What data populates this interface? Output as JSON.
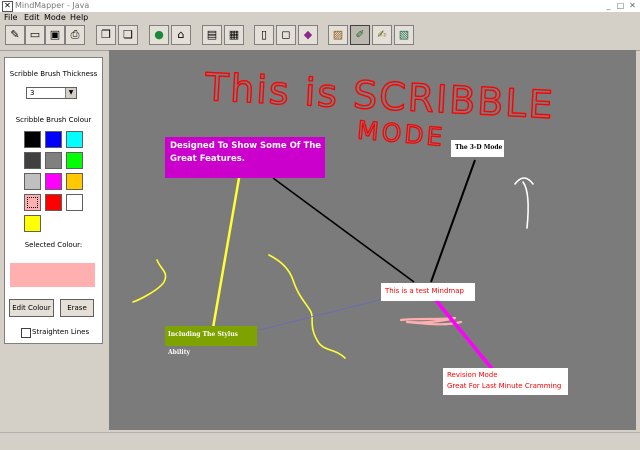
{
  "window": {
    "title": "MindMapper - Java",
    "icon_glyph": "✕",
    "controls": [
      "_",
      "□",
      "✕"
    ]
  },
  "menu": [
    "File",
    "Edit",
    "Mode",
    "Help"
  ],
  "toolbar": [
    {
      "icon": "new-document-icon",
      "glyph": "✎"
    },
    {
      "icon": "open-folder-icon",
      "glyph": "▭"
    },
    {
      "icon": "save-icon",
      "glyph": "▣"
    },
    {
      "icon": "print-icon",
      "glyph": "⎙"
    },
    {
      "icon": "copy-icon",
      "glyph": "❐"
    },
    {
      "icon": "paste-icon",
      "glyph": "❏"
    },
    {
      "icon": "globe-icon",
      "glyph": "●"
    },
    {
      "icon": "home-icon",
      "glyph": "⌂"
    },
    {
      "icon": "properties-icon",
      "glyph": "▤"
    },
    {
      "icon": "image-settings-icon",
      "glyph": "▦"
    },
    {
      "icon": "page-icon",
      "glyph": "▯"
    },
    {
      "icon": "node-icon",
      "glyph": "◻"
    },
    {
      "icon": "3d-mode-icon",
      "glyph": "◆"
    },
    {
      "icon": "picture-mode-icon",
      "glyph": "▨"
    },
    {
      "icon": "scribble-mode-icon",
      "glyph": "✐"
    },
    {
      "icon": "revision-mode-icon",
      "glyph": "✍"
    },
    {
      "icon": "style-mode-icon",
      "glyph": "▧"
    }
  ],
  "panel": {
    "thickness_label": "Scribble Brush Thickness",
    "thickness_value": "3",
    "colour_label": "Scribble Brush Colour",
    "swatches": [
      "#000000",
      "#0000ff",
      "#00ffff",
      "#404040",
      "#808080",
      "#00ff00",
      "#c0c0c0",
      "#ff00ff",
      "#ffc800",
      "#ffafaf",
      "#ff0000",
      "#ffffff",
      "#ffff00"
    ],
    "selected_swatch_index": 9,
    "selected_label": "Selected Colour:",
    "selected_color": "#ffafaf",
    "edit_button": "Edit Colour",
    "erase_button": "Erase",
    "straighten_label": "Straighten Lines",
    "straighten_checked": false
  },
  "canvas": {
    "background": "#7b7b7b",
    "nodes": [
      {
        "id": "features",
        "text": [
          "Designed To Show Some Of The",
          "Great Features."
        ],
        "bg": "#cc00cc",
        "fg": "#ffffff"
      },
      {
        "id": "three-d",
        "text": [
          "The 3-D Mode"
        ],
        "bg": "#ffffff",
        "fg": "#000000"
      },
      {
        "id": "test",
        "text": [
          "This is a test Mindmap"
        ],
        "bg": "#ffffff",
        "fg": "#ff0000"
      },
      {
        "id": "stylus",
        "text": [
          "Including The Stylus Ability"
        ],
        "bg": "#7ea300",
        "fg": "#ffffff"
      },
      {
        "id": "revision",
        "text": [
          "Revision Mode",
          "Great For Last Minute Cramming"
        ],
        "bg": "#ffffff",
        "fg": "#ff0000"
      }
    ],
    "links": [
      {
        "color": "#ffff33"
      },
      {
        "color": "#000000"
      },
      {
        "color": "#000000"
      },
      {
        "color": "#6666cc"
      },
      {
        "color": "#ff00ff"
      }
    ],
    "scribble": {
      "line1": "This is SCRIBBLE",
      "line2": "MODE",
      "color": "#ff0000"
    }
  }
}
